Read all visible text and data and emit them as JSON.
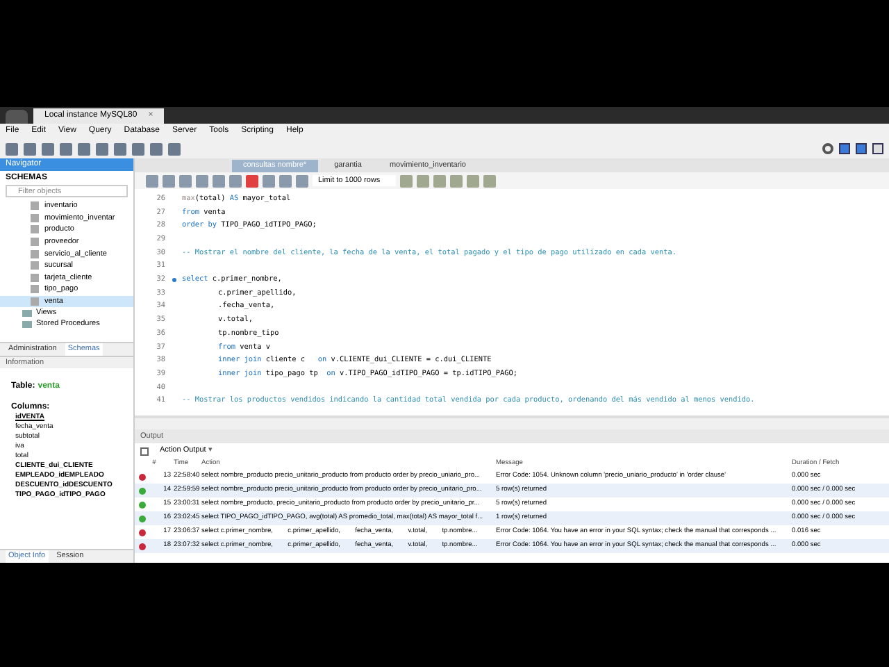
{
  "window": {
    "tab": "Local instance MySQL80",
    "tab_close": "×"
  },
  "menu": [
    "File",
    "Edit",
    "View",
    "Query",
    "Database",
    "Server",
    "Tools",
    "Scripting",
    "Help"
  ],
  "navigator": {
    "title": "Navigator",
    "schemas_label": "SCHEMAS",
    "filter_placeholder": "Filter objects",
    "tables": [
      {
        "name": "inventario",
        "selected": false
      },
      {
        "name": "movimiento_inventar",
        "selected": false
      },
      {
        "name": "producto",
        "selected": false
      },
      {
        "name": "proveedor",
        "selected": false
      },
      {
        "name": "servicio_al_cliente",
        "selected": false
      },
      {
        "name": "sucursal",
        "selected": false
      },
      {
        "name": "tarjeta_cliente",
        "selected": false
      },
      {
        "name": "tipo_pago",
        "selected": false
      },
      {
        "name": "venta",
        "selected": true
      }
    ],
    "folders": [
      "Views",
      "Stored Procedures"
    ],
    "tabs": [
      {
        "label": "Administration",
        "selected": false
      },
      {
        "label": "Schemas",
        "selected": true
      }
    ]
  },
  "information": {
    "title": "Information",
    "table_label": "Table:",
    "table_name": "venta",
    "columns_label": "Columns:",
    "columns": [
      {
        "name": "idVENTA",
        "kind": "primary"
      },
      {
        "name": "fecha_venta",
        "kind": "plain"
      },
      {
        "name": "subtotal",
        "kind": "plain"
      },
      {
        "name": "iva",
        "kind": "plain"
      },
      {
        "name": "total",
        "kind": "plain"
      },
      {
        "name": "CLIENTE_dui_CLIENTE",
        "kind": "foreign"
      },
      {
        "name": "EMPLEADO_idEMPLEADO",
        "kind": "foreign"
      },
      {
        "name": "DESCUENTO_idDESCUENTO",
        "kind": "foreign"
      },
      {
        "name": "TIPO_PAGO_idTIPO_PAGO",
        "kind": "foreign"
      }
    ],
    "tabs": [
      {
        "label": "Object Info",
        "selected": true
      },
      {
        "label": "Session",
        "selected": false
      }
    ]
  },
  "editor": {
    "tabs": [
      {
        "label": "consultas nombre*",
        "selected": true
      },
      {
        "label": "garantia",
        "selected": false
      },
      {
        "label": "movimiento_inventario",
        "selected": false
      }
    ],
    "limit": "Limit to 1000 rows",
    "lines": [
      {
        "number": "26",
        "marker": false,
        "segments": [
          {
            "kind": "fn",
            "text": "max"
          },
          {
            "kind": "plain",
            "text": "(total) "
          },
          {
            "kind": "keyword",
            "text": "AS"
          },
          {
            "kind": "plain",
            "text": " mayor_total"
          }
        ]
      },
      {
        "number": "27",
        "marker": false,
        "segments": [
          {
            "kind": "keyword",
            "text": "from"
          },
          {
            "kind": "plain",
            "text": " venta"
          }
        ]
      },
      {
        "number": "28",
        "marker": false,
        "segments": [
          {
            "kind": "keyword",
            "text": "order by"
          },
          {
            "kind": "plain",
            "text": " TIPO_PAGO_idTIPO_PAGO;"
          }
        ]
      },
      {
        "number": "29",
        "marker": false
      },
      {
        "number": "30",
        "marker": false,
        "segments": [
          {
            "kind": "comment",
            "text": "-- Mostrar el nombre del cliente, la fecha de la venta, el total pagado y el tipo de pago utilizado en cada venta."
          }
        ]
      },
      {
        "number": "31",
        "marker": false
      },
      {
        "number": "32",
        "marker": true,
        "segments": [
          {
            "kind": "keyword",
            "text": "select"
          },
          {
            "kind": "plain",
            "text": " c.primer_nombre,"
          }
        ]
      },
      {
        "number": "33",
        "marker": false,
        "indented": true,
        "segments": [
          {
            "kind": "plain",
            "text": "c.primer_apellido,"
          }
        ]
      },
      {
        "number": "34",
        "marker": false,
        "indented": true,
        "segments": [
          {
            "kind": "plain",
            "text": ".fecha_venta,"
          }
        ]
      },
      {
        "number": "35",
        "marker": false,
        "indented": true,
        "segments": [
          {
            "kind": "plain",
            "text": "v.total,"
          }
        ]
      },
      {
        "number": "36",
        "marker": false,
        "indented": true,
        "segments": [
          {
            "kind": "plain",
            "text": "tp.nombre_tipo"
          }
        ]
      },
      {
        "number": "37",
        "marker": false,
        "indented": true,
        "segments": [
          {
            "kind": "keyword",
            "text": "from"
          },
          {
            "kind": "plain",
            "text": " venta v"
          }
        ]
      },
      {
        "number": "38",
        "marker": false,
        "indented": true,
        "segments": [
          {
            "kind": "keyword",
            "text": "inner join"
          },
          {
            "kind": "plain",
            "text": " cliente c   "
          },
          {
            "kind": "keyword",
            "text": "on"
          },
          {
            "kind": "plain",
            "text": " v.CLIENTE_dui_CLIENTE = c.dui_CLIENTE"
          }
        ]
      },
      {
        "number": "39",
        "marker": false,
        "indented": true,
        "segments": [
          {
            "kind": "keyword",
            "text": "inner join"
          },
          {
            "kind": "plain",
            "text": " tipo_pago tp  "
          },
          {
            "kind": "keyword",
            "text": "on"
          },
          {
            "kind": "plain",
            "text": " v.TIPO_PAGO_idTIPO_PAGO = tp.idTIPO_PAGO;"
          }
        ]
      },
      {
        "number": "40",
        "marker": false
      },
      {
        "number": "41",
        "marker": false,
        "segments": [
          {
            "kind": "comment",
            "text": "-- Mostrar los productos vendidos indicando la cantidad total vendida por cada producto, ordenando del más vendido al menos vendido."
          }
        ]
      }
    ]
  },
  "output": {
    "title": "Output",
    "selector": "Action Output",
    "selector_caret": "▾",
    "columns": [
      "#",
      "Time",
      "Action",
      "Message",
      "Duration / Fetch"
    ],
    "rows": [
      {
        "kind": "error",
        "number": "13",
        "time": "22:58:40",
        "action": "select nombre_producto precio_unitario_producto from producto order by precio_uniario_pro...",
        "message": "Error Code: 1054. Unknown column 'precio_uniario_producto' in 'order clause'",
        "duration": "0.000 sec"
      },
      {
        "kind": "ok",
        "number": "14",
        "time": "22:59:59",
        "action": "select nombre_producto precio_unitario_producto from producto order by precio_unitario_pro...",
        "message": "5 row(s) returned",
        "duration": "0.000 sec / 0.000 sec"
      },
      {
        "kind": "ok",
        "number": "15",
        "time": "23:00:31",
        "action": "select nombre_producto, precio_unitario_producto from producto order by precio_unitario_pr...",
        "message": "5 row(s) returned",
        "duration": "0.000 sec / 0.000 sec"
      },
      {
        "kind": "ok",
        "number": "16",
        "time": "23:02:45",
        "action": "select TIPO_PAGO_idTIPO_PAGO, avg(total) AS promedio_total, max(total) AS mayor_total f...",
        "message": "1 row(s) returned",
        "duration": "0.000 sec / 0.000 sec"
      },
      {
        "kind": "error",
        "number": "17",
        "time": "23:06:37",
        "action": "select c.primer_nombre,        c.primer_apellido,        fecha_venta,        v.total,        tp.nombre...",
        "message": "Error Code: 1064. You have an error in your SQL syntax; check the manual that corresponds ...",
        "duration": "0.016 sec"
      },
      {
        "kind": "error",
        "number": "18",
        "time": "23:07:32",
        "action": "select c.primer_nombre,        c.primer_apellido,        fecha_venta,        v.total,        tp.nombre...",
        "message": "Error Code: 1064. You have an error in your SQL syntax; check the manual that corresponds ...",
        "duration": "0.000 sec"
      }
    ]
  }
}
